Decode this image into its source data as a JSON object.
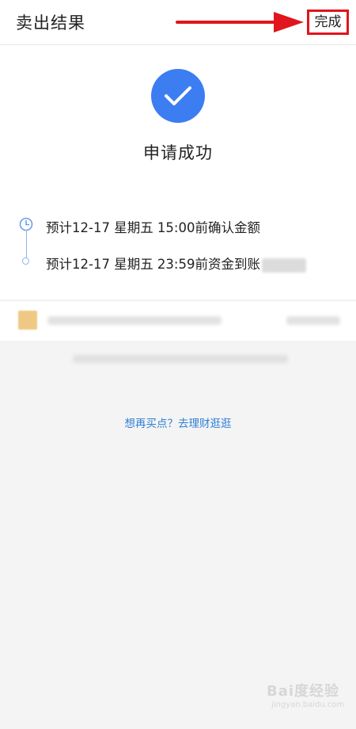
{
  "header": {
    "title": "卖出结果",
    "done_label": "完成"
  },
  "result": {
    "status_text": "申请成功"
  },
  "timeline": {
    "items": [
      {
        "text": "预计12-17 星期五 15:00前确认金额"
      },
      {
        "text": "预计12-17 星期五 23:59前资金到账"
      }
    ]
  },
  "footer": {
    "link_text": "想再买点？去理财逛逛"
  },
  "watermark": {
    "text": "Bai度经验",
    "sub": "jingyan.baidu.com"
  },
  "colors": {
    "accent": "#3c7df2",
    "link": "#2f7fd6",
    "highlight_box": "#e0151d"
  }
}
